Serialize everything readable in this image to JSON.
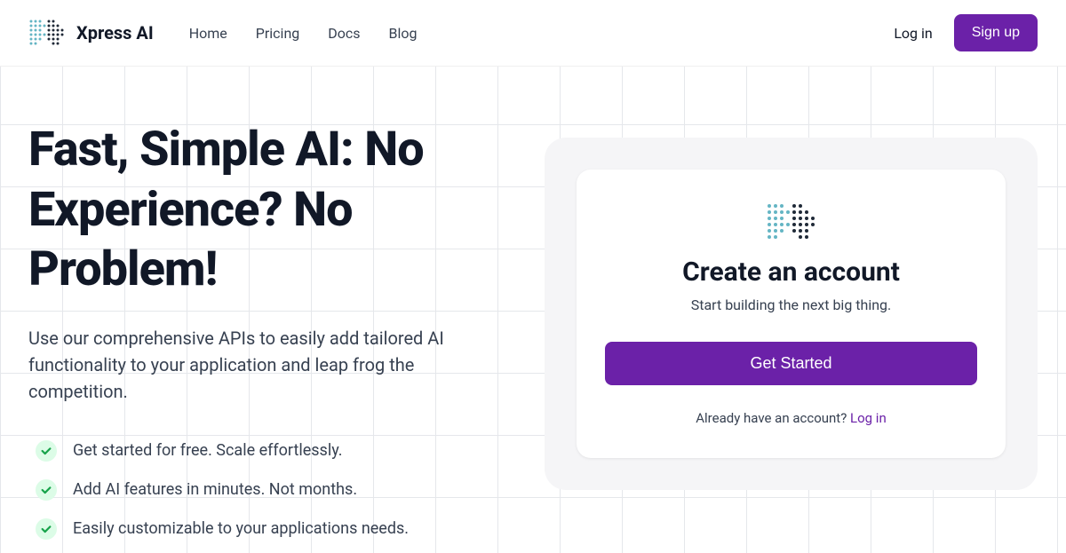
{
  "brand": "Xpress AI",
  "nav": {
    "home": "Home",
    "pricing": "Pricing",
    "docs": "Docs",
    "blog": "Blog"
  },
  "header": {
    "login": "Log in",
    "signup": "Sign up"
  },
  "hero": {
    "title": "Fast, Simple AI: No Experience? No Problem!",
    "subtitle": "Use our comprehensive APIs to easily add tailored AI functionality to your application and leap frog the competition."
  },
  "features": [
    "Get started for free. Scale effortlessly.",
    "Add AI features in minutes. Not months.",
    "Easily customizable to your applications needs."
  ],
  "signup": {
    "title": "Create an account",
    "subtitle": "Start building the next big thing.",
    "cta": "Get Started",
    "already_text": "Already have an account? ",
    "already_link": "Log in"
  }
}
